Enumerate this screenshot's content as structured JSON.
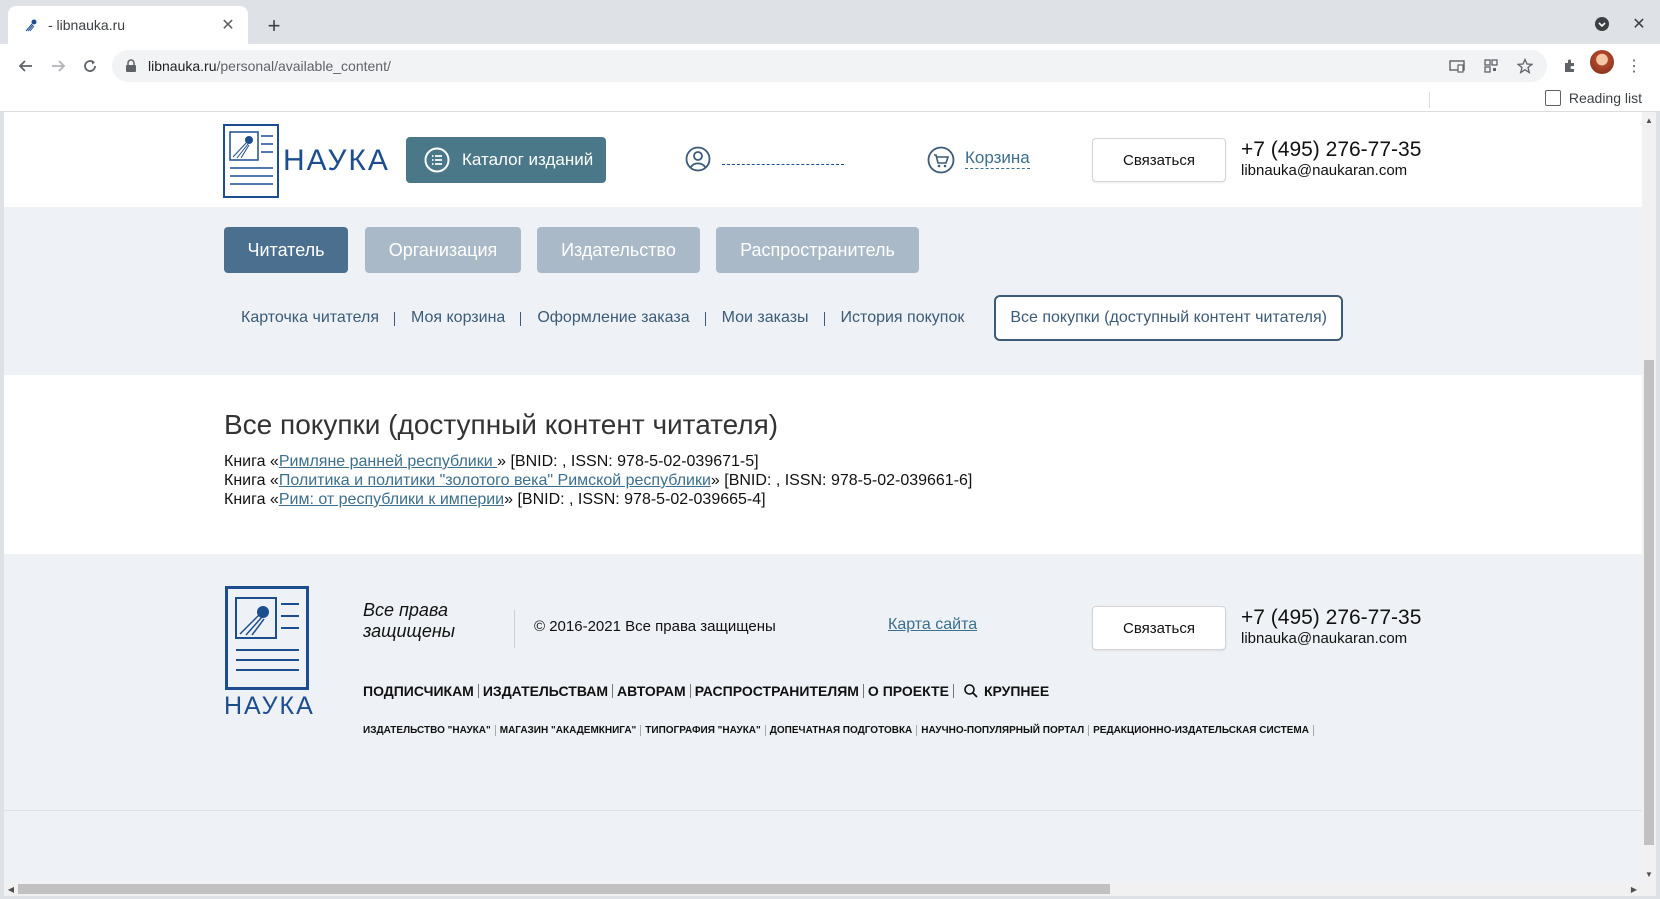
{
  "browser": {
    "tab_title": "- libnauka.ru",
    "url_host": "libnauka.ru",
    "url_path": "/personal/available_content/",
    "reading_list": "Reading list"
  },
  "header": {
    "logo_text": "НАУКА",
    "catalog_button": "Каталог изданий",
    "cart_link": "Корзина",
    "contact_button": "Связаться",
    "phone": "+7 (495) 276-77-35",
    "email": "libnauka@naukaran.com"
  },
  "roles": [
    "Читатель",
    "Организация",
    "Издательство",
    "Распространитель"
  ],
  "subnav": [
    "Карточка читателя",
    "Моя корзина",
    "Оформление заказа",
    "Мои заказы",
    "История покупок",
    "Все покупки (доступный контент читателя)"
  ],
  "page_title": "Все покупки (доступный контент читателя)",
  "books": [
    {
      "prefix": "Книга «",
      "title": "Римляне ранней республики ",
      "suffix": "» [BNID: , ISSN: 978-5-02-039671-5]"
    },
    {
      "prefix": "Книга «",
      "title": "Политика и политики \"золотого века\" Римской республики",
      "suffix": "» [BNID: , ISSN: 978-5-02-039661-6]"
    },
    {
      "prefix": "Книга «",
      "title": "Рим: от республики к империи",
      "suffix": "» [BNID: , ISSN: 978-5-02-039665-4]"
    }
  ],
  "footer": {
    "logo_text": "НАУКА",
    "rights_italic": "Все права защищены",
    "copyright": "© 2016-2021 Все права защищены",
    "sitemap": "Карта сайта",
    "contact_button": "Связаться",
    "phone": "+7 (495) 276-77-35",
    "email": "libnauka@naukaran.com",
    "nav": [
      "ПОДПИСЧИКАМ",
      "ИЗДАТЕЛЬСТВАМ",
      "АВТОРАМ",
      "РАСПРОСТРАНИТЕЛЯМ",
      "О ПРОЕКТЕ"
    ],
    "larger": "КРУПНЕЕ",
    "sub_links": [
      "ИЗДАТЕЛЬСТВО \"НАУКА\"",
      "МАГАЗИН \"АКАДЕМКНИГА\"",
      "ТИПОГРАФИЯ \"НАУКА\"",
      "ДОПЕЧАТНАЯ ПОДГОТОВКА",
      "НАУЧНО-ПОПУЛЯРНЫЙ ПОРТАЛ",
      "РЕДАКЦИОННО-ИЗДАТЕЛЬСКАЯ СИСТЕМА"
    ]
  }
}
